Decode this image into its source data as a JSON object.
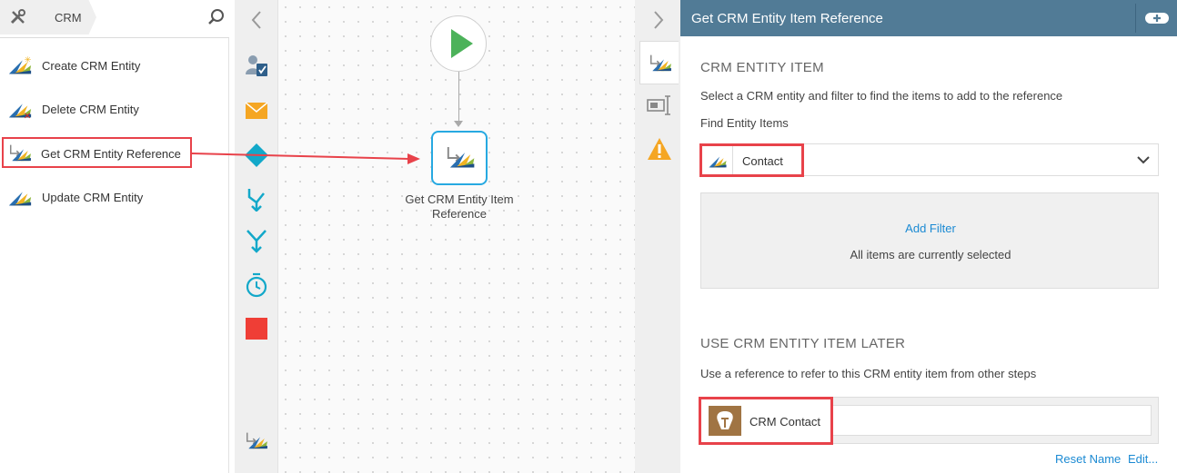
{
  "toolbox": {
    "breadcrumb": "CRM",
    "items": [
      {
        "label": "Create CRM Entity",
        "icon": "crm-create-icon"
      },
      {
        "label": "Delete CRM Entity",
        "icon": "crm-delete-icon"
      },
      {
        "label": "Get CRM Entity Reference",
        "icon": "crm-get-reference-icon"
      },
      {
        "label": "Update CRM Entity",
        "icon": "crm-update-icon"
      }
    ]
  },
  "canvas": {
    "step_label": "Get CRM Entity Item Reference"
  },
  "panel": {
    "title": "Get CRM Entity Item Reference",
    "section1": {
      "title": "CRM ENTITY ITEM",
      "description": "Select a CRM entity and filter to find the items to add to the reference",
      "find_label": "Find Entity Items",
      "selected_entity": "Contact",
      "filter_link": "Add Filter",
      "filter_status": "All items are currently selected"
    },
    "section2": {
      "title": "USE CRM ENTITY ITEM LATER",
      "description": "Use a reference to refer to this CRM entity item from other steps",
      "reference_name": "CRM Contact",
      "reset_link": "Reset Name",
      "edit_link": "Edit..."
    }
  },
  "colors": {
    "highlight": "#e8424a",
    "panel_header": "#517b96",
    "link": "#1b8ad3",
    "step_border": "#27a9e1",
    "start_green": "#4cb25a",
    "stop_red": "#ef3e36"
  }
}
